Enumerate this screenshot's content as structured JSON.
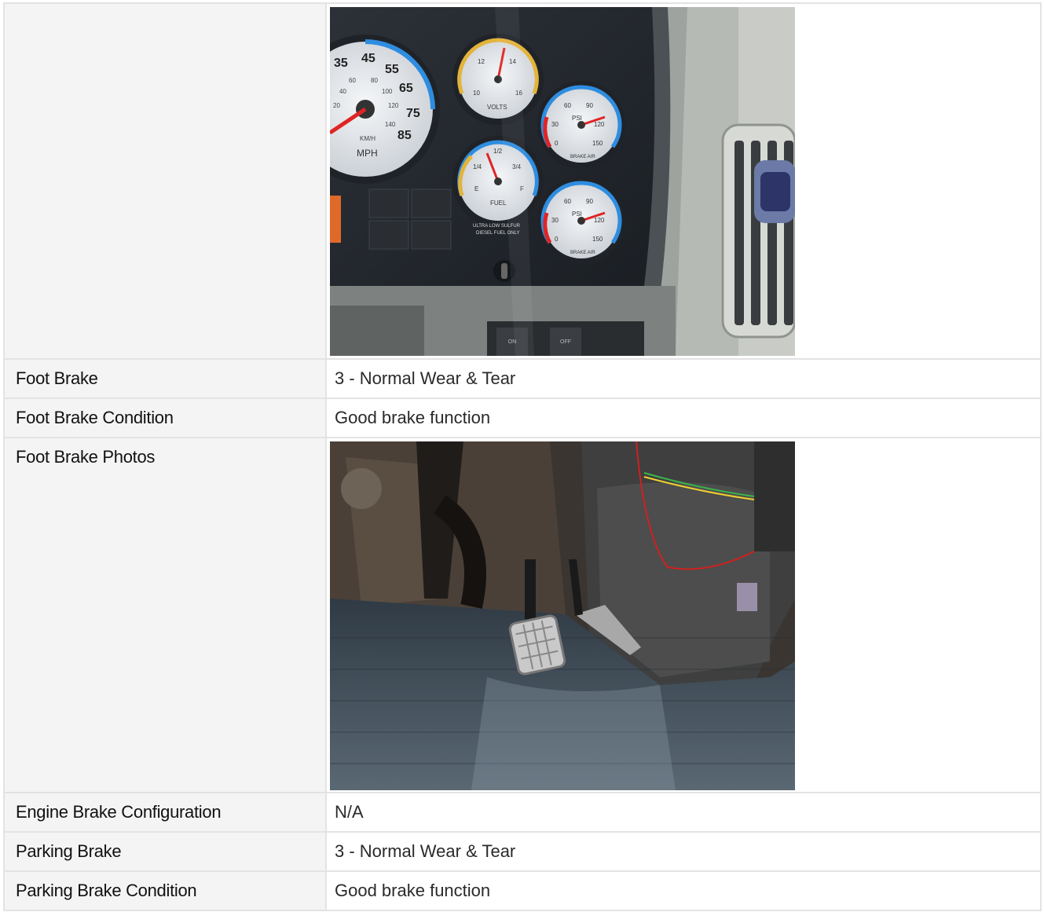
{
  "rows": [
    {
      "label": "",
      "type": "photo",
      "photo": "dashboard-gauges-photo"
    },
    {
      "label": "Foot Brake",
      "value": "3 - Normal Wear & Tear"
    },
    {
      "label": "Foot Brake Condition",
      "value": "Good brake function"
    },
    {
      "label": "Foot Brake Photos",
      "type": "photo",
      "photo": "foot-brake-pedal-photo"
    },
    {
      "label": "Engine Brake Configuration",
      "value": "N/A"
    },
    {
      "label": "Parking Brake",
      "value": "3 - Normal Wear & Tear"
    },
    {
      "label": "Parking Brake Condition",
      "value": "Good brake function"
    }
  ],
  "photo1": {
    "speedo_numbers": [
      "35",
      "45",
      "55",
      "65",
      "75",
      "85",
      "60",
      "80",
      "100",
      "120",
      "140",
      "40",
      "20"
    ],
    "speedo_units": [
      "KM/H",
      "MPH"
    ],
    "volts": {
      "ticks": [
        "12",
        "14",
        "10",
        "16"
      ],
      "label": "VOLTS"
    },
    "fuel": {
      "ticks": [
        "1/2",
        "1/4",
        "3/4",
        "E",
        "F"
      ],
      "label": "FUEL",
      "note1": "ULTRA LOW SULFUR",
      "note2": "DIESEL FUEL ONLY"
    },
    "air": {
      "ticks": [
        "60",
        "90",
        "30",
        "120",
        "0",
        "150"
      ],
      "label": "PSI",
      "sub": "BRAKE AIR"
    },
    "switch_labels": [
      "ON",
      "OFF"
    ]
  }
}
